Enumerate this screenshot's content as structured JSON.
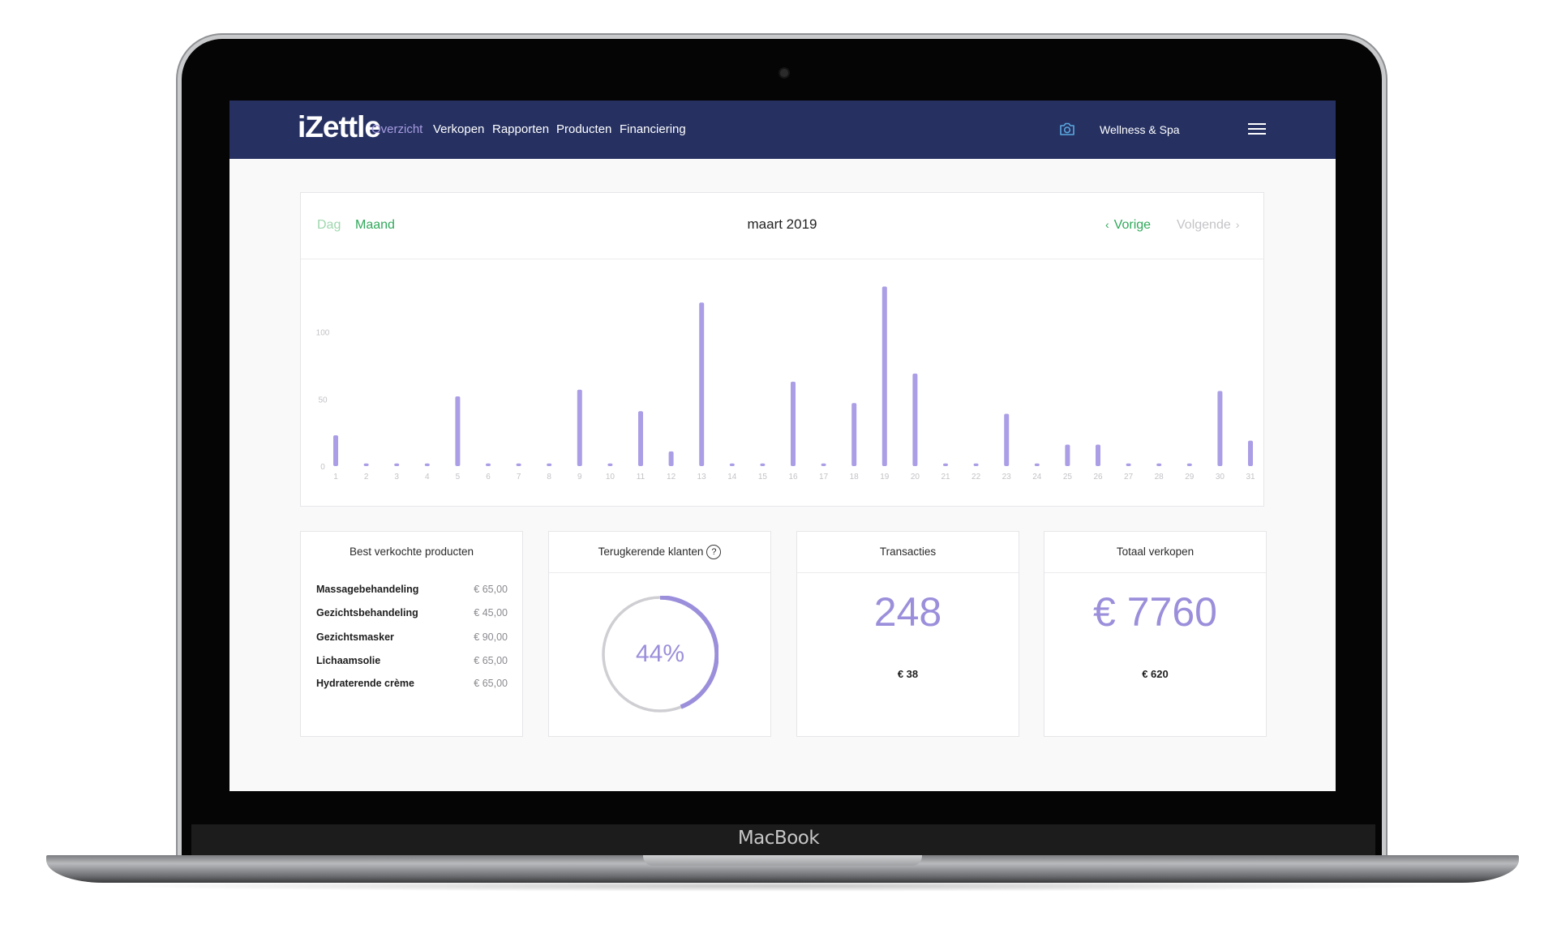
{
  "device": {
    "brand_label": "MacBook"
  },
  "nav": {
    "logo": "iZettle",
    "items": [
      {
        "label": "Overzicht",
        "active": true
      },
      {
        "label": "Verkopen",
        "active": false
      },
      {
        "label": "Rapporten",
        "active": false
      },
      {
        "label": "Producten",
        "active": false
      },
      {
        "label": "Financiering",
        "active": false
      }
    ],
    "camera_icon": "camera-icon",
    "store_name": "Wellness & Spa",
    "menu_icon": "hamburger-menu-icon"
  },
  "period": {
    "tabs": {
      "day": "Dag",
      "month": "Maand"
    },
    "selected": "Maand",
    "label": "maart 2019",
    "prev": "Vorige",
    "next": "Volgende"
  },
  "chart_data": {
    "type": "bar",
    "categories": [
      "1",
      "2",
      "3",
      "4",
      "5",
      "6",
      "7",
      "8",
      "9",
      "10",
      "11",
      "12",
      "13",
      "14",
      "15",
      "16",
      "17",
      "18",
      "19",
      "20",
      "21",
      "22",
      "23",
      "24",
      "25",
      "26",
      "27",
      "28",
      "29",
      "30",
      "31"
    ],
    "values": [
      23,
      2,
      2,
      2,
      52,
      2,
      2,
      2,
      57,
      2,
      41,
      11,
      122,
      2,
      2,
      63,
      2,
      47,
      134,
      69,
      2,
      2,
      39,
      2,
      16,
      16,
      2,
      2,
      2,
      56,
      19
    ],
    "ylim": [
      0,
      150
    ],
    "yticks": [
      "0",
      "50",
      "100"
    ],
    "bar_color": "#ab9ee6",
    "grid": false
  },
  "best_products": {
    "title": "Best verkochte producten",
    "items": [
      {
        "name": "Massagebehandeling",
        "price": "€ 65,00"
      },
      {
        "name": "Gezichtsbehandeling",
        "price": "€ 45,00"
      },
      {
        "name": "Gezichtsmasker",
        "price": "€ 90,00"
      },
      {
        "name": "Lichaamsolie",
        "price": "€ 65,00"
      },
      {
        "name": "Hydraterende crème",
        "price": "€ 65,00"
      }
    ]
  },
  "returning_customers": {
    "title": "Terugkerende klanten",
    "help": "?",
    "percent_label": "44%",
    "percent": 44,
    "ring_color": "#9b8fdb"
  },
  "transactions": {
    "title": "Transacties",
    "value": "248",
    "sub": "€ 38"
  },
  "total_sales": {
    "title": "Totaal verkopen",
    "value": "€ 7760",
    "sub": "€ 620"
  },
  "colors": {
    "nav_bg": "#263162",
    "accent_purple": "#9b8fdb",
    "accent_green": "#2fa95a"
  }
}
